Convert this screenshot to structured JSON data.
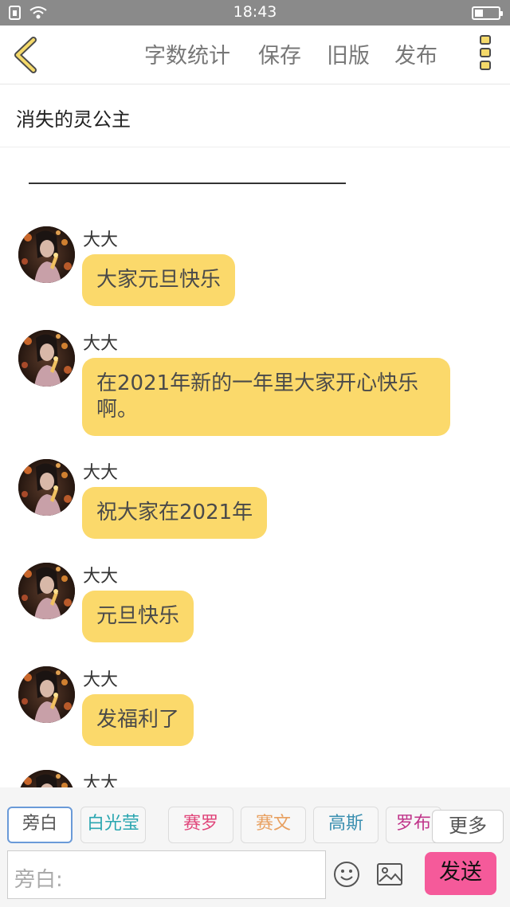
{
  "status_bar": {
    "time": "18:43",
    "battery_level": 0.35
  },
  "toolbar": {
    "actions": [
      "字数统计",
      "保存",
      "旧版",
      "发布"
    ]
  },
  "story": {
    "title": "消失的灵公主"
  },
  "messages": [
    {
      "sender": "大大",
      "text": "大家元旦快乐"
    },
    {
      "sender": "大大",
      "text": "在2021年新的一年里大家开心快乐啊。"
    },
    {
      "sender": "大大",
      "text": "祝大家在2021年"
    },
    {
      "sender": "大大",
      "text": "元旦快乐"
    },
    {
      "sender": "大大",
      "text": "发福利了"
    },
    {
      "sender": "大大",
      "text": ""
    }
  ],
  "roles": [
    {
      "name": "旁白",
      "color": "#555555"
    },
    {
      "name": "白光莹",
      "color": "#2aa6b0"
    },
    {
      "name": "赛罗",
      "color": "#e0457a"
    },
    {
      "name": "赛文",
      "color": "#e8a060"
    },
    {
      "name": "高斯",
      "color": "#3a8fb0"
    },
    {
      "name": "罗布",
      "color": "#c0348a"
    }
  ],
  "more_roles_label": "更多",
  "input": {
    "placeholder": "旁白:"
  },
  "send_label": "发送",
  "colors": {
    "bubble": "#fbd96b",
    "send": "#f55a9a",
    "active_role_border": "#6a9ad8"
  }
}
